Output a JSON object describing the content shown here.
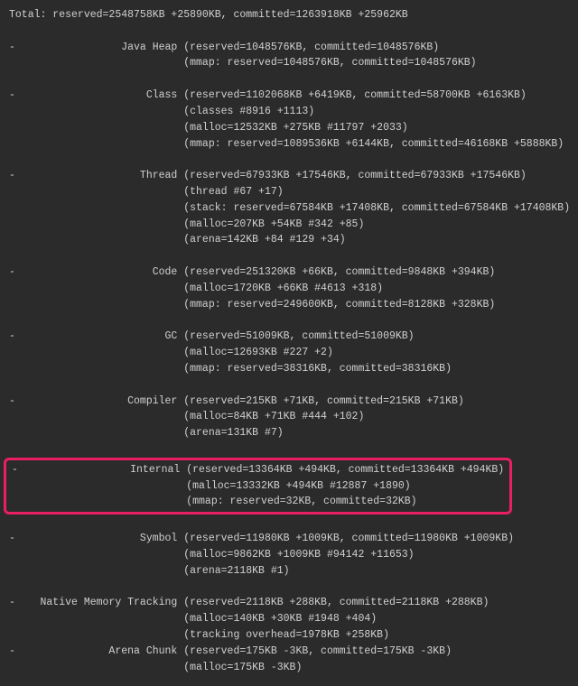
{
  "terminal": {
    "total": "Total: reserved=2548758KB +25890KB, committed=1263918KB +25962KB",
    "sections": [
      {
        "dash": "-",
        "name": "Java Heap",
        "main": "(reserved=1048576KB, committed=1048576KB)",
        "extra": [
          "(mmap: reserved=1048576KB, committed=1048576KB)"
        ],
        "highlight": false
      },
      {
        "dash": "-",
        "name": "Class",
        "main": "(reserved=1102068KB +6419KB, committed=58700KB +6163KB)",
        "extra": [
          "(classes #8916 +1113)",
          "(malloc=12532KB +275KB #11797 +2033)",
          "(mmap: reserved=1089536KB +6144KB, committed=46168KB +5888KB)"
        ],
        "highlight": false
      },
      {
        "dash": "-",
        "name": "Thread",
        "main": "(reserved=67933KB +17546KB, committed=67933KB +17546KB)",
        "extra": [
          "(thread #67 +17)",
          "(stack: reserved=67584KB +17408KB, committed=67584KB +17408KB)",
          "(malloc=207KB +54KB #342 +85)",
          "(arena=142KB +84 #129 +34)"
        ],
        "highlight": false
      },
      {
        "dash": "-",
        "name": "Code",
        "main": "(reserved=251320KB +66KB, committed=9848KB +394KB)",
        "extra": [
          "(malloc=1720KB +66KB #4613 +318)",
          "(mmap: reserved=249600KB, committed=8128KB +328KB)"
        ],
        "highlight": false
      },
      {
        "dash": "-",
        "name": "GC",
        "main": "(reserved=51009KB, committed=51009KB)",
        "extra": [
          "(malloc=12693KB #227 +2)",
          "(mmap: reserved=38316KB, committed=38316KB)"
        ],
        "highlight": false
      },
      {
        "dash": "-",
        "name": "Compiler",
        "main": "(reserved=215KB +71KB, committed=215KB +71KB)",
        "extra": [
          "(malloc=84KB +71KB #444 +102)",
          "(arena=131KB #7)"
        ],
        "highlight": false
      },
      {
        "dash": "-",
        "name": "Internal",
        "main": "(reserved=13364KB +494KB, committed=13364KB +494KB)",
        "extra": [
          "(malloc=13332KB +494KB #12887 +1890)",
          "(mmap: reserved=32KB, committed=32KB)"
        ],
        "highlight": true
      },
      {
        "dash": "-",
        "name": "Symbol",
        "main": "(reserved=11980KB +1009KB, committed=11980KB +1009KB)",
        "extra": [
          "(malloc=9862KB +1009KB #94142 +11653)",
          "(arena=2118KB #1)"
        ],
        "highlight": false
      },
      {
        "dash": "-",
        "name": "Native Memory Tracking",
        "main": "(reserved=2118KB +288KB, committed=2118KB +288KB)",
        "extra": [
          "(malloc=140KB +30KB #1948 +404)",
          "(tracking overhead=1978KB +258KB)"
        ],
        "highlight": false
      },
      {
        "dash": "-",
        "name": "Arena Chunk",
        "main": "(reserved=175KB -3KB, committed=175KB -3KB)",
        "extra": [
          "(malloc=175KB -3KB)"
        ],
        "highlight": false
      }
    ]
  },
  "layout": {
    "label_col_width": 27,
    "continuation_col": 28
  }
}
